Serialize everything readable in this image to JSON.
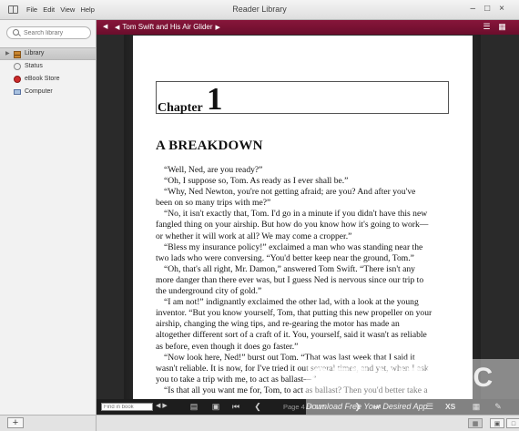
{
  "window": {
    "title": "Reader Library",
    "menu": [
      "File",
      "Edit",
      "View",
      "Help"
    ]
  },
  "sidebar": {
    "search_placeholder": "Search library",
    "items": [
      {
        "label": "Library",
        "icon": "library-icon",
        "selected": true
      },
      {
        "label": "Status",
        "icon": "status-icon",
        "selected": false
      },
      {
        "label": "eBook Store",
        "icon": "ebook-store-icon",
        "selected": false
      },
      {
        "label": "Computer",
        "icon": "computer-icon",
        "selected": false
      }
    ],
    "add_label": "+"
  },
  "toolbar": {
    "book_title": "Tom Swift and His Air Glider",
    "accent_color": "#7a1033"
  },
  "page": {
    "chapter_word": "Chapter",
    "chapter_number": "1",
    "heading": "A BREAKDOWN",
    "lines": [
      "“Well, Ned, are you ready?”",
      "“Oh, I suppose so, Tom. As ready as I ever shall be.”",
      "“Why, Ned Newton, you're not getting afraid; are you? And after you've",
      "been on so many trips with me?”",
      "“No, it isn't exactly that, Tom. I'd go in a minute if you didn't have this new",
      "fangled thing on your airship. But how do you know how it's going to work—",
      "or whether it will work at all? We may come a cropper.”",
      "“Bless my insurance policy!” exclaimed a man who was standing near the",
      "two lads who were conversing. “You'd better keep near the ground, Tom.”",
      "“Oh, that's all right, Mr. Damon,” answered Tom Swift. “There isn't any",
      "more danger than there ever was, but I guess Ned is nervous since our trip to",
      "the underground city of gold.”",
      "“I am not!” indignantly exclaimed the other lad, with a look at the young",
      "inventor. “But you know yourself, Tom, that putting this new propeller on your",
      "airship, changing the wing tips, and re-gearing the motor has made an",
      "altogether different sort of a craft of it. You, yourself, said it wasn't as reliable",
      "as before, even though it does go faster.”",
      "“Now look here, Ned!” burst out Tom. “That was last week that I said it",
      "wasn't reliable. It is now, for I've tried it out several times, and yet, when I ask",
      "you to take a trip with me, to act as ballast—”",
      "“Is that all you want me for, Tom, to act as ballast? Then you'd better take a"
    ]
  },
  "bottom": {
    "find_placeholder": "Find in book",
    "page_label": "Page 4 of 125",
    "font_size_label": "XS"
  },
  "watermark": {
    "big": "GET INTO PC",
    "small": "Download Free Your Desired App"
  }
}
